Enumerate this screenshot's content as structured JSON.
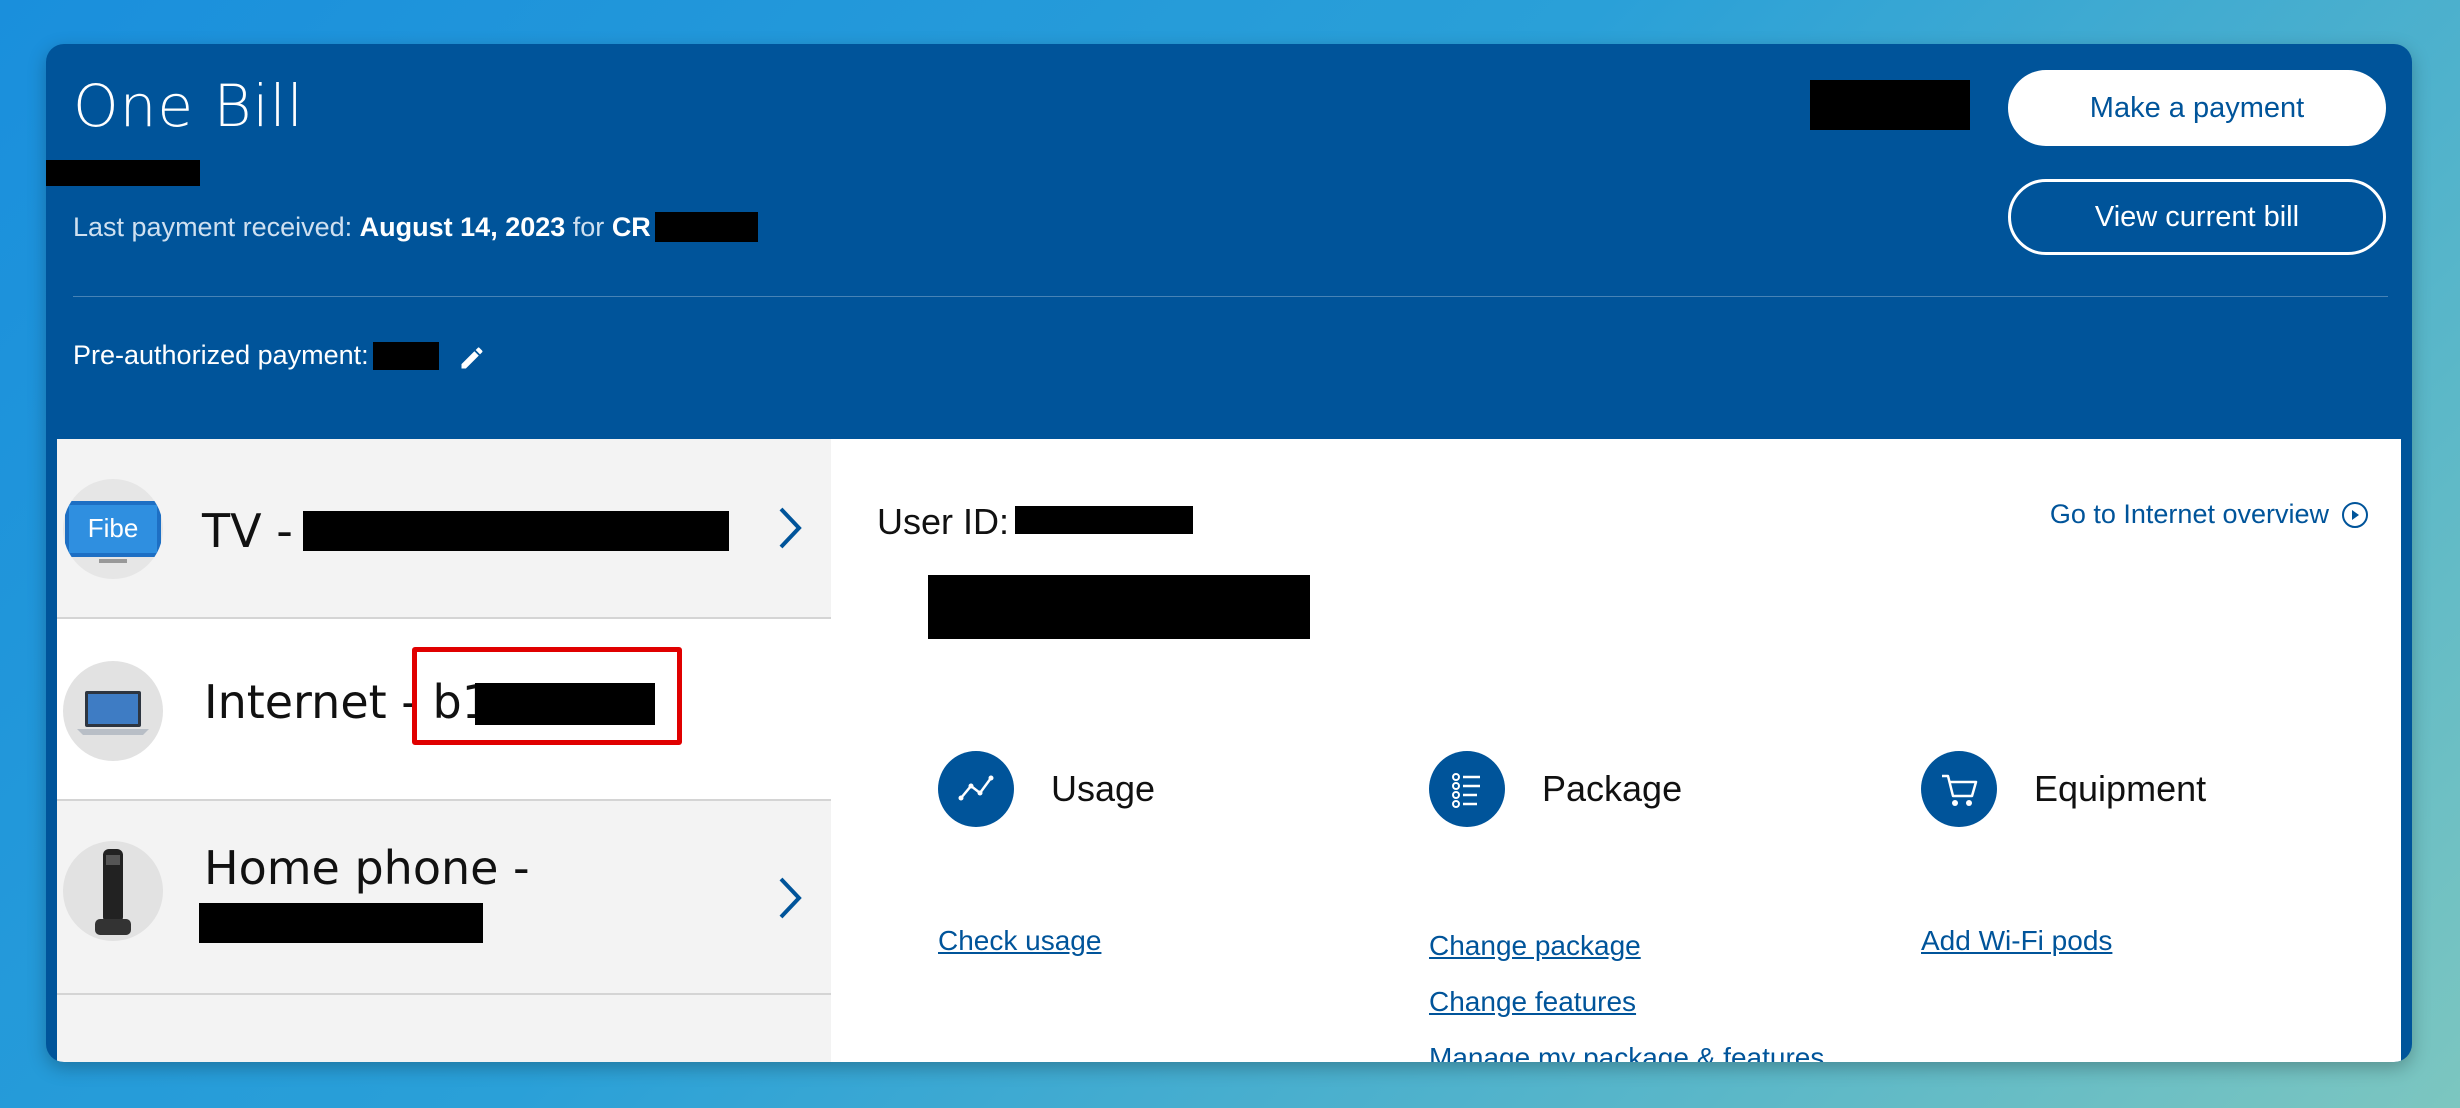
{
  "bill": {
    "title": "One Bill",
    "last_payment_label": "Last payment received:",
    "last_payment_date": "August 14, 2023",
    "last_payment_for": "for",
    "last_payment_account_prefix": "CR",
    "preauth_label": "Pre-authorized payment:"
  },
  "actions": {
    "make_payment": "Make a payment",
    "view_bill": "View current bill"
  },
  "services": [
    {
      "label": "TV -",
      "icon": "fibe-tv-icon",
      "icon_text": "Fibe"
    },
    {
      "label": "Internet - b1",
      "icon": "laptop-icon"
    },
    {
      "label": "Home phone -",
      "icon": "cordless-phone-icon"
    }
  ],
  "details": {
    "user_id_label": "User ID:",
    "goto_link": "Go to Internet overview",
    "features": [
      {
        "title": "Usage",
        "icon": "usage-chart-icon",
        "links": [
          "Check usage"
        ]
      },
      {
        "title": "Package",
        "icon": "checklist-icon",
        "links": [
          "Change package",
          "Change features",
          "Manage my package & features"
        ]
      },
      {
        "title": "Equipment",
        "icon": "cart-icon",
        "links": [
          "Add Wi-Fi pods"
        ]
      }
    ]
  },
  "colors": {
    "brand_blue": "#00549a",
    "highlight_red": "#e00000"
  }
}
